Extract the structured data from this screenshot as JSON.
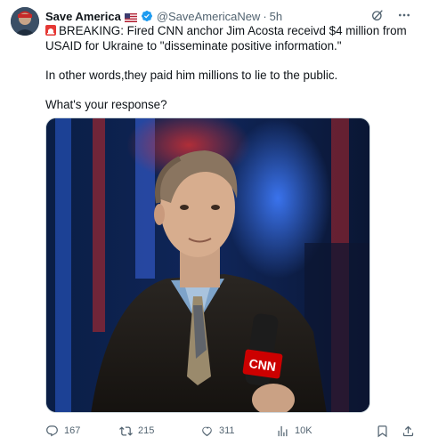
{
  "post": {
    "author": {
      "display_name": "Save America",
      "flag_icon": "us-flag-icon",
      "verified_icon": "verified-badge-icon",
      "handle": "@SaveAmericaNew",
      "separator": "·",
      "time": "5h"
    },
    "body": {
      "siren_icon": "siren-icon",
      "line1": "BREAKING: Fired CNN anchor Jim Acosta receivd $4 million from USAID for Ukraine to \"disseminate positive information.\"",
      "line2": "In other words,they paid him millions to lie to the public.",
      "line3": "What's your response?"
    },
    "media": {
      "type": "photo",
      "microphone_label": "CNN"
    },
    "actions": {
      "replies": "167",
      "reposts": "215",
      "likes": "311",
      "views": "10K"
    },
    "colors": {
      "text": "#0f1419",
      "secondary": "#536471",
      "verified": "#1d9bf0",
      "border": "#cfd9de"
    }
  }
}
